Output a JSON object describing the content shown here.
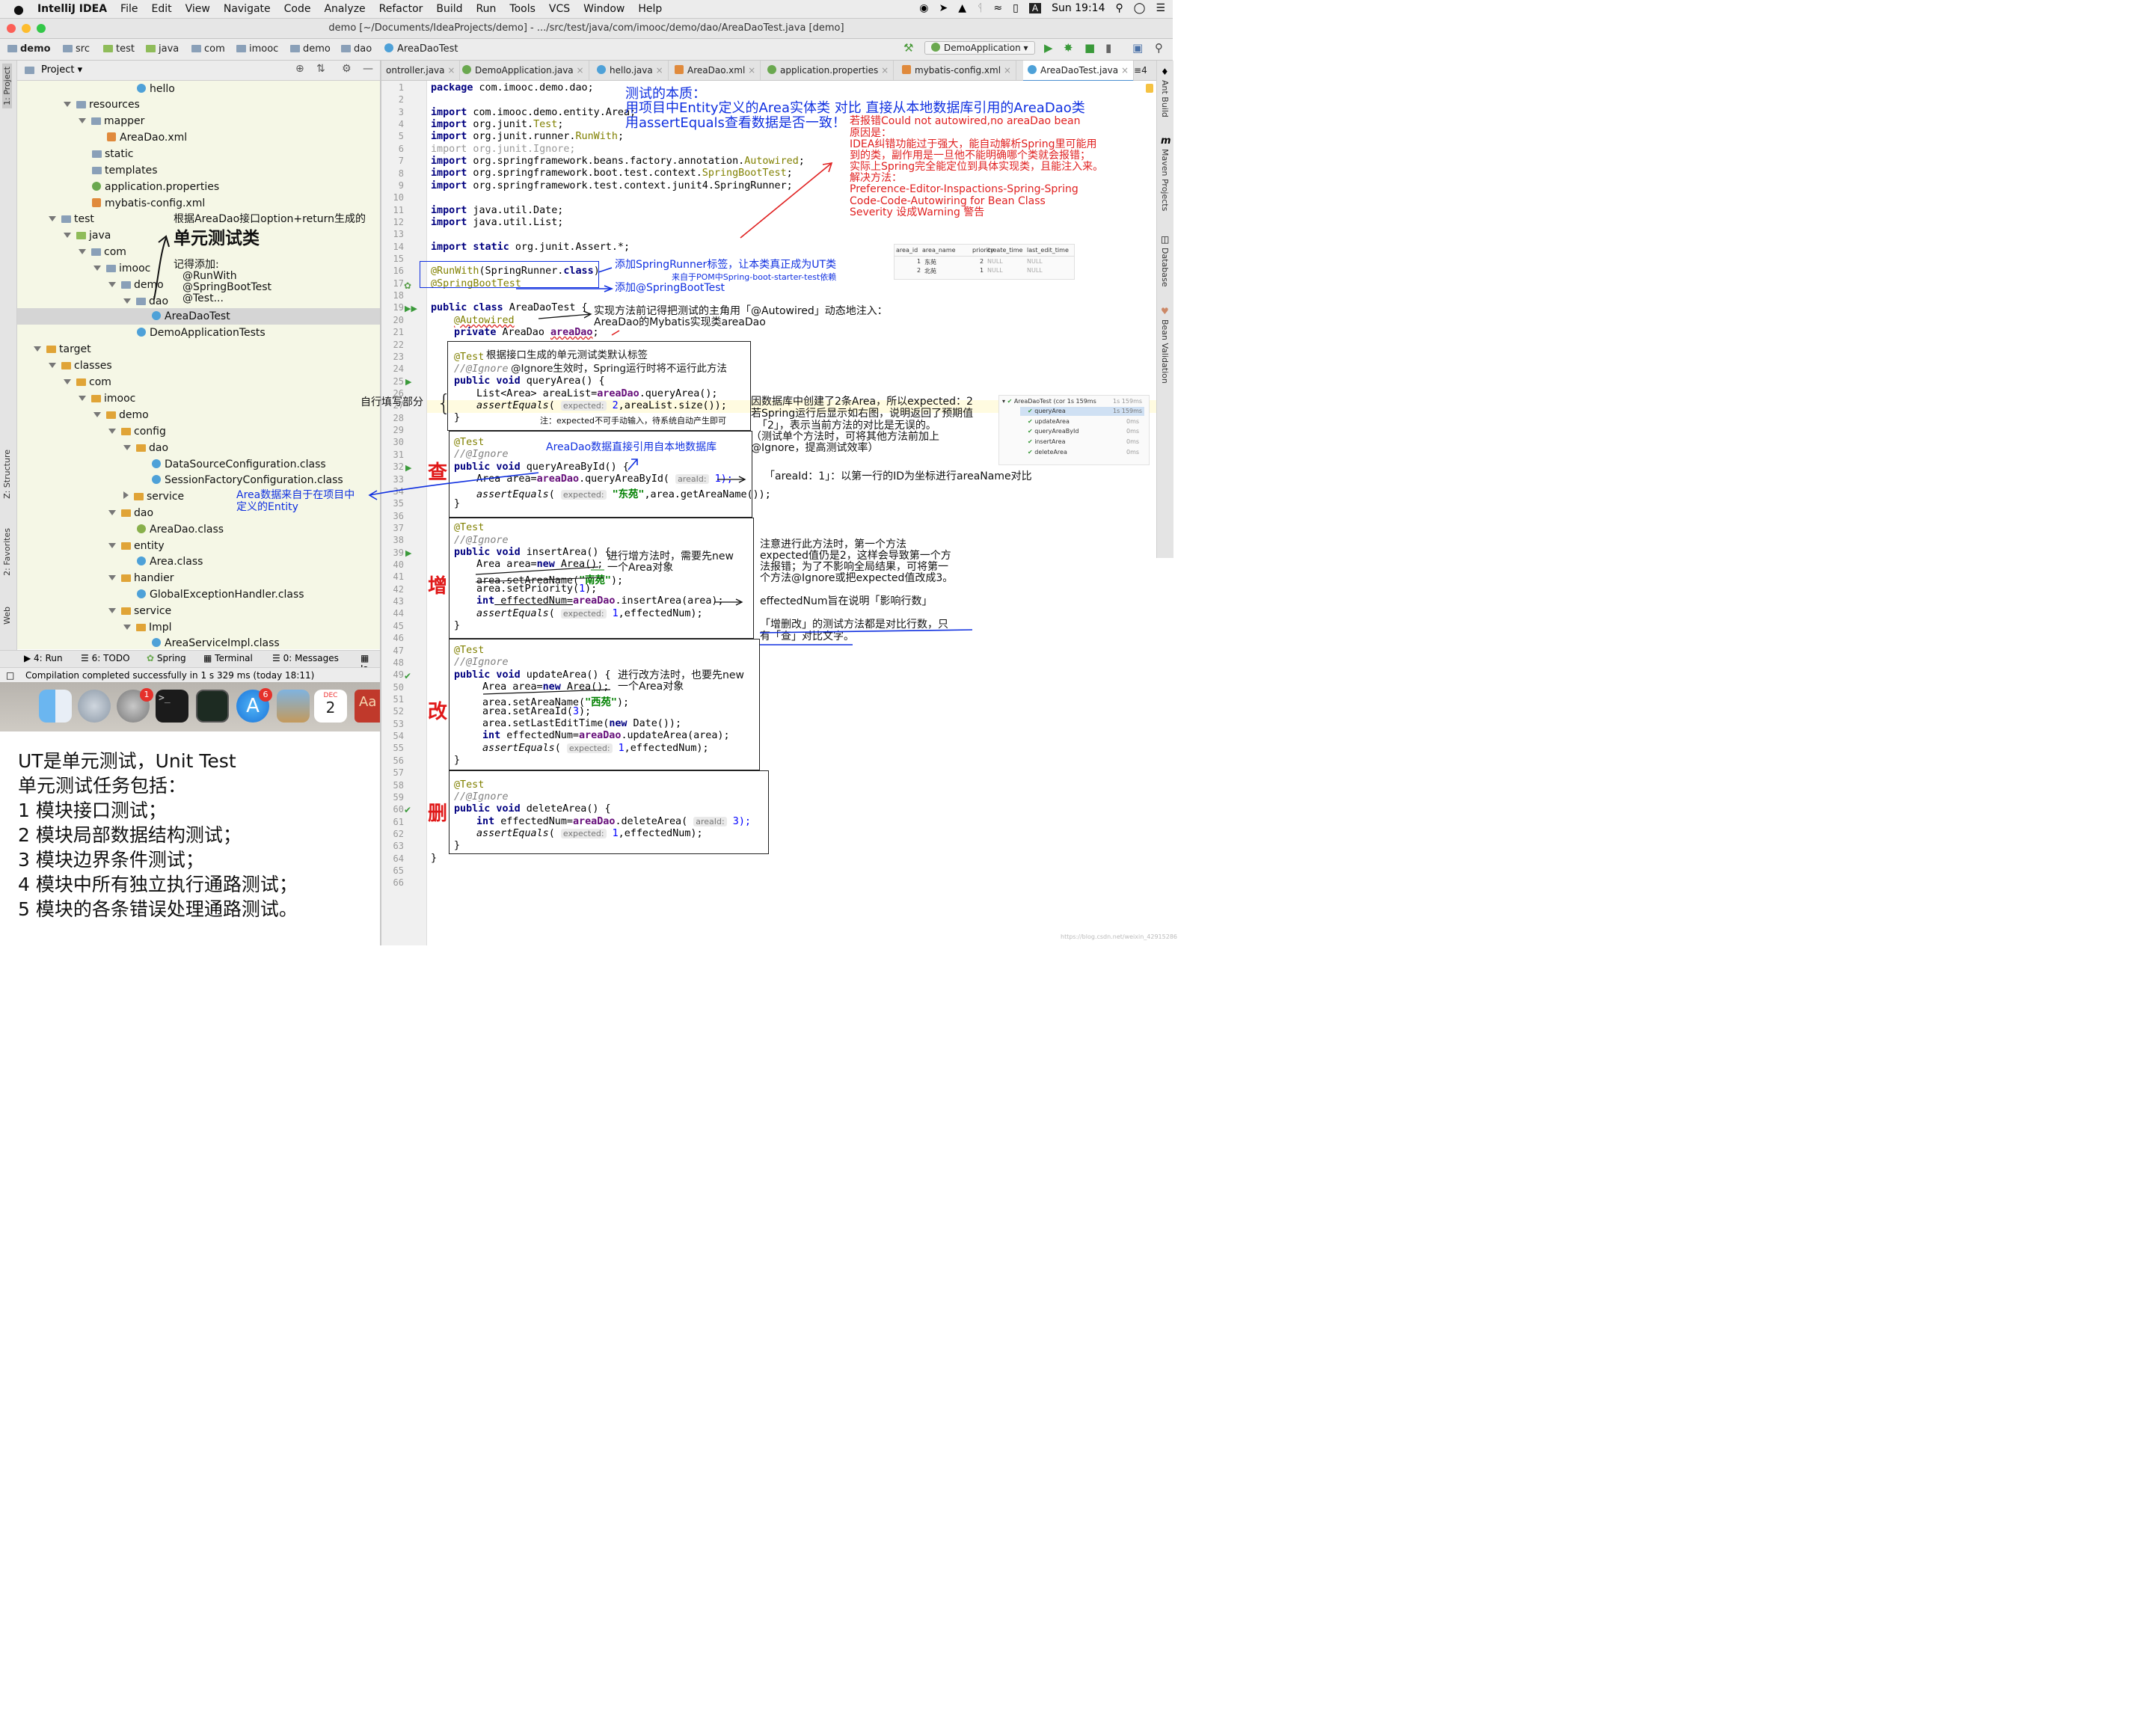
{
  "menubar": {
    "app": "IntelliJ IDEA",
    "items": [
      "File",
      "Edit",
      "View",
      "Navigate",
      "Code",
      "Analyze",
      "Refactor",
      "Build",
      "Run",
      "Tools",
      "VCS",
      "Window",
      "Help"
    ],
    "clock": "Sun 19:14",
    "input_badge": "A"
  },
  "window": {
    "title": "demo [~/Documents/IdeaProjects/demo] - .../src/test/java/com/imooc/demo/dao/AreaDaoTest.java [demo]"
  },
  "breadcrumb": [
    "demo",
    "src",
    "test",
    "java",
    "com",
    "imooc",
    "demo",
    "dao",
    "AreaDaoTest"
  ],
  "run_config": "DemoApplication",
  "project_panel": {
    "title": "Project",
    "items": [
      {
        "label": "hello"
      },
      {
        "label": "resources"
      },
      {
        "label": "mapper"
      },
      {
        "label": "AreaDao.xml"
      },
      {
        "label": "static"
      },
      {
        "label": "templates"
      },
      {
        "label": "application.properties"
      },
      {
        "label": "mybatis-config.xml"
      },
      {
        "label": "test"
      },
      {
        "label": "java"
      },
      {
        "label": "com"
      },
      {
        "label": "imooc"
      },
      {
        "label": "demo"
      },
      {
        "label": "dao"
      },
      {
        "label": "AreaDaoTest"
      },
      {
        "label": "DemoApplicationTests"
      },
      {
        "label": "target"
      },
      {
        "label": "classes"
      },
      {
        "label": "com"
      },
      {
        "label": "imooc"
      },
      {
        "label": "demo"
      },
      {
        "label": "config"
      },
      {
        "label": "dao"
      },
      {
        "label": "DataSourceConfiguration.class"
      },
      {
        "label": "SessionFactoryConfiguration.class"
      },
      {
        "label": "service"
      },
      {
        "label": "dao"
      },
      {
        "label": "AreaDao.class"
      },
      {
        "label": "entity"
      },
      {
        "label": "Area.class"
      },
      {
        "label": "handier"
      },
      {
        "label": "GlobalExceptionHandler.class"
      },
      {
        "label": "service"
      },
      {
        "label": "Impl"
      },
      {
        "label": "AreaServiceImpl.class"
      }
    ]
  },
  "left_strip": {
    "project": "1: Project",
    "structure": "Z: Structure",
    "favorites": "2: Favorites",
    "web": "Web"
  },
  "right_strip": {
    "ant": "Ant Build",
    "maven": "Maven Projects",
    "database": "Database",
    "bean": "Bean Validation"
  },
  "bottom_tools": {
    "run": "4: Run",
    "todo": "6: TODO",
    "spring": "Spring",
    "terminal": "Terminal",
    "messages": "0: Messages",
    "more": "Ja"
  },
  "status": "Compilation completed successfully in 1 s 329 ms (today 18:11)",
  "dock": {
    "badge1": "1",
    "badge2": "6",
    "cal_month": "DEC",
    "cal_day": "2"
  },
  "tabs": [
    "ontroller.java",
    "DemoApplication.java",
    "hello.java",
    "AreaDao.xml",
    "application.properties",
    "mybatis-config.xml",
    "AreaDaoTest.java"
  ],
  "tabs_more": "4",
  "line_numbers": [
    "1",
    "2",
    "3",
    "4",
    "5",
    "6",
    "7",
    "8",
    "9",
    "10",
    "11",
    "12",
    "13",
    "14",
    "15",
    "16",
    "17",
    "18",
    "19",
    "20",
    "21",
    "22",
    "23",
    "24",
    "25",
    "26",
    "27",
    "28",
    "29",
    "30",
    "31",
    "32",
    "33",
    "34",
    "35",
    "36",
    "37",
    "38",
    "39",
    "40",
    "41",
    "42",
    "43",
    "44",
    "45",
    "46",
    "47",
    "48",
    "49",
    "50",
    "51",
    "52",
    "53",
    "54",
    "55",
    "56",
    "57",
    "58",
    "59",
    "60",
    "61",
    "62",
    "63",
    "64",
    "65",
    "66"
  ],
  "code": {
    "l1_kw": "package",
    "l1": " com.imooc.demo.dao;",
    "imp": "import",
    "l3": " com.imooc.demo.entity.Area;",
    "l4a": " org.junit.",
    "l4b": "Test",
    "l5a": " org.junit.runner.",
    "l5b": "RunWith",
    "l6": " org.junit.Ignore;",
    "l7a": " org.springframework.beans.factory.annotation.",
    "l7b": "Autowired",
    "l8a": " org.springframework.boot.test.context.",
    "l8b": "SpringBootTest",
    "l9": " org.springframework.test.context.junit4.SpringRunner;",
    "l11": " java.util.Date;",
    "l12": " java.util.List;",
    "l14kw": "import static",
    "l14": " org.junit.Assert.*;",
    "l16a": "@RunWith",
    "l16b": "(SpringRunner.",
    "l16c": "class",
    "l16d": ")",
    "l17": "@SpringBootTest",
    "l19kw": "public class",
    "l19": " AreaDaoTest {",
    "l20": "@Autowired",
    "l21kw": "private",
    "l21a": " AreaDao ",
    "l21b": "areaDao",
    "test_ann": "@Test",
    "ignore": "//@Ignore",
    "pubvoid": "public void",
    "l25": " queryArea() {",
    "l26a": "List<Area> areaList=",
    "l26b": "areaDao",
    "l26c": ".queryArea();",
    "ae": "assertEquals",
    "hint_expected": "expected:",
    "l27a": " 2",
    "l27b": ",areaList.size());",
    "close": "}",
    "l32": " queryAreaById() {",
    "l33a": "Area area=",
    "l33b": "areaDao",
    ".l33c": "",
    "l33c": ".queryAreaById(",
    "hint_areaid": "areaId:",
    "l33d": " 1);",
    "l34b": "\"东苑\"",
    "l34c": ",area.getAreaName());",
    "l39": " insertArea() {",
    "l40a": "Area area=",
    "newkw": "new",
    "l40b": " Area();",
    "l41a": "area.setAreaName(",
    "l41b": "\"南苑\"",
    "l41c": ");",
    "l42a": "area.setPriority(",
    "l42b": "1",
    "l42c": ");",
    "intkw": "int",
    "l43a": " effectedNum=",
    "l43b": "areaDao",
    "l43c": ".insertArea(area);",
    "l44b": " 1",
    "l44c": ",effectedNum);",
    "l49": " updateArea() {",
    "l51b": "\"西苑\"",
    "l52a": "area.setAreaId(",
    "l52b": "3",
    "l52c": ");",
    "l53a": "area.setLastEditTime(",
    "l53b": " Date());",
    "l54c": ".updateArea(area);",
    "l60": " deleteArea() {",
    "l61c": ".deleteArea(",
    "l61d": " 3);"
  },
  "annotations": {
    "essence1": "测试的本质：",
    "essence2": "用项目中Entity定义的Area实体类 对比 直接从本地数据库引用的AreaDao类",
    "essence3": "用assertEquals查看数据是否一致！",
    "err1": "若报错Could not autowired,no areaDao bean",
    "err2": "原因是：",
    "err3": "IDEA纠错功能过于强大，能自动解析Spring里可能用",
    "err4": "到的类，副作用是一旦他不能明确哪个类就会报错；",
    "err5": "实际上Spring完全能定位到具体实现类，且能注入来。",
    "err6": "解决方法：",
    "err7": "Preference-Editor-Inspactions-Spring-Spring",
    "err8": "Code-Code-Autowiring for Bean Class",
    "err9": "Severity 设成Warning 警告",
    "gen1": "根据AreaDao接口option+return生成的",
    "gen2": "单元测试类",
    "remember": "记得添加:",
    "rem1": "@RunWith",
    "rem2": "@SpringBootTest",
    "rem3": "@Test...",
    "runner1": "添加SpringRunner标签，让本类真正成为UT类",
    "runner2": "来自于POM中Spring-boot-starter-test依赖",
    "runner3": "添加@SpringBootTest",
    "impl1": "实现方法前记得把测试的主角用「@Autowired」动态地注入：",
    "impl2": "AreaDao的Mybatis实现类areaDao",
    "default_tag": "根据接口生成的单元测试类默认标签",
    "ignore_note": "@Ignore生效时，Spring运行时将不运行此方法",
    "self_write": "自行填写部分",
    "expected_note": "注：expected不可手动输入，待系统自动产生即可",
    "db1": "因数据库中创建了2条Area，所以expected：2",
    "db2": "若Spring运行后显示如右图，说明返回了预期值",
    "db3": "「2」，表示当前方法的对比是无误的。",
    "db4": "（测试单个方法时，可将其他方法前加上",
    "db5": "@Ignore，提高测试效率）",
    "direct_db": "AreaDao数据直接引用自本地数据库",
    "entity1": "Area数据来自于在项目中",
    "entity2": "定义的Entity",
    "areaid_note": "「areaId：1」：以第一行的ID为坐标进行areaName对比",
    "cha": "查",
    "zeng": "增",
    "gai": "改",
    "shan": "删",
    "insert1": "进行增方法时，需要先new",
    "insert2": "一个Area对象",
    "update1": "进行改方法时，也要先new",
    "update2": "一个Area对象",
    "att1": "注意进行此方法时，第一个方法",
    "att2": "expected值仍是2，这样会导致第一个方",
    "att3": "法报错；为了不影响全局结果，可将第一",
    "att4": "个方法@Ignore或把expected值改成3。",
    "effected": "effectedNum旨在说明「影响行数」",
    "compare1": "「增删改」的测试方法都是对比行数，只",
    "compare2": "有「查」对比文字。"
  },
  "db_table": {
    "headers": [
      "area_id",
      "area_name",
      "priority",
      "create_time",
      "last_edit_time"
    ],
    "rows": [
      [
        "1",
        "东苑",
        "2",
        "NULL",
        "NULL"
      ],
      [
        "2",
        "北苑",
        "1",
        "NULL",
        "NULL"
      ]
    ]
  },
  "test_results": {
    "root": "AreaDaoTest (cor 1s 159ms",
    "root_time": "1s 159ms",
    "items": [
      [
        "queryArea",
        "1s 159ms"
      ],
      [
        "updateArea",
        "0ms"
      ],
      [
        "queryAreaById",
        "0ms"
      ],
      [
        "insertArea",
        "0ms"
      ],
      [
        "deleteArea",
        "0ms"
      ]
    ]
  },
  "ut_notes": {
    "l1": "UT是单元测试，Unit Test",
    "l2": "单元测试任务包括：",
    "l3": "1 模块接口测试；",
    "l4": "2 模块局部数据结构测试；",
    "l5": "3 模块边界条件测试；",
    "l6": "4 模块中所有独立执行通路测试；",
    "l7": "5 模块的各条错误处理通路测试。"
  },
  "watermark": "https://blog.csdn.net/weixin_42915286",
  "colors": {
    "accent": "#4b8fd0",
    "annotation_blue": "#1030e0",
    "annotation_red": "#e02020",
    "tree_bg": "#f5f7e6"
  }
}
